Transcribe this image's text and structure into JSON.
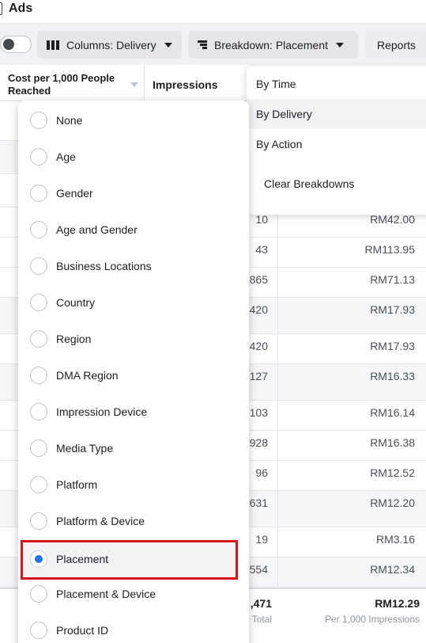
{
  "title": "Ads",
  "toolbar": {
    "columns_label": "Columns: Delivery",
    "breakdown_label": "Breakdown: Placement",
    "reports_label": "Reports"
  },
  "table": {
    "header_cost": "Cost per 1,000 People Reached",
    "header_impressions": "Impressions",
    "rows": [
      {
        "impressions": "10",
        "cost": "RM42.00"
      },
      {
        "impressions": "43",
        "cost": "RM113.95"
      },
      {
        "impressions": "865",
        "cost": "RM71.13"
      },
      {
        "impressions": "420",
        "cost": "RM17.93"
      },
      {
        "impressions": "420",
        "cost": "RM17.93"
      },
      {
        "impressions": "127",
        "cost": "RM16.33"
      },
      {
        "impressions": "103",
        "cost": "RM16.14"
      },
      {
        "impressions": "928",
        "cost": "RM16.38"
      },
      {
        "impressions": "96",
        "cost": "RM12.52"
      },
      {
        "impressions": "631",
        "cost": "RM12.20"
      },
      {
        "impressions": "19",
        "cost": "RM3.16"
      },
      {
        "impressions": "554",
        "cost": "RM12.34"
      }
    ],
    "summary": {
      "impressions": ",471",
      "impressions_label": "Total",
      "cost": "RM12.29",
      "cost_label": "Per 1,000 Impressions"
    }
  },
  "breakdown_menu": {
    "items": [
      "By Time",
      "By Delivery",
      "By Action"
    ],
    "hovered": "By Delivery",
    "clear_label": "Clear Breakdowns"
  },
  "delivery_submenu": {
    "items": [
      "None",
      "Age",
      "Gender",
      "Age and Gender",
      "Business Locations",
      "Country",
      "Region",
      "DMA Region",
      "Impression Device",
      "Media Type",
      "Platform",
      "Platform & Device",
      "Placement",
      "Placement & Device",
      "Product ID"
    ],
    "selected": "Placement"
  },
  "colors": {
    "accent": "#1877f2",
    "highlight": "#d4151c"
  }
}
